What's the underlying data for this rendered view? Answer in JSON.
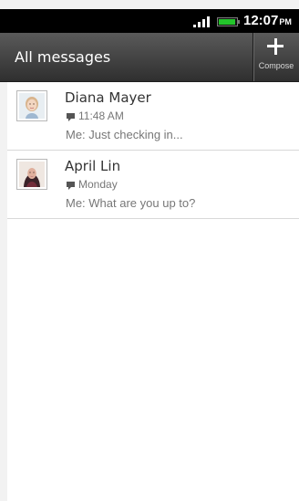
{
  "status_bar": {
    "time": "12:07",
    "ampm": "PM",
    "icons": [
      "signal-icon",
      "battery-icon"
    ],
    "battery_color": "#23c42b"
  },
  "app_bar": {
    "title": "All messages",
    "compose_label": "Compose",
    "compose_icon": "plus-icon"
  },
  "threads": [
    {
      "name": "Diana Mayer",
      "time": "11:48 AM",
      "preview": "Me: Just checking in...",
      "icon": "chat-bubble-icon"
    },
    {
      "name": "April Lin",
      "time": "Monday",
      "preview": "Me: What are you up to?",
      "icon": "chat-bubble-icon"
    }
  ]
}
